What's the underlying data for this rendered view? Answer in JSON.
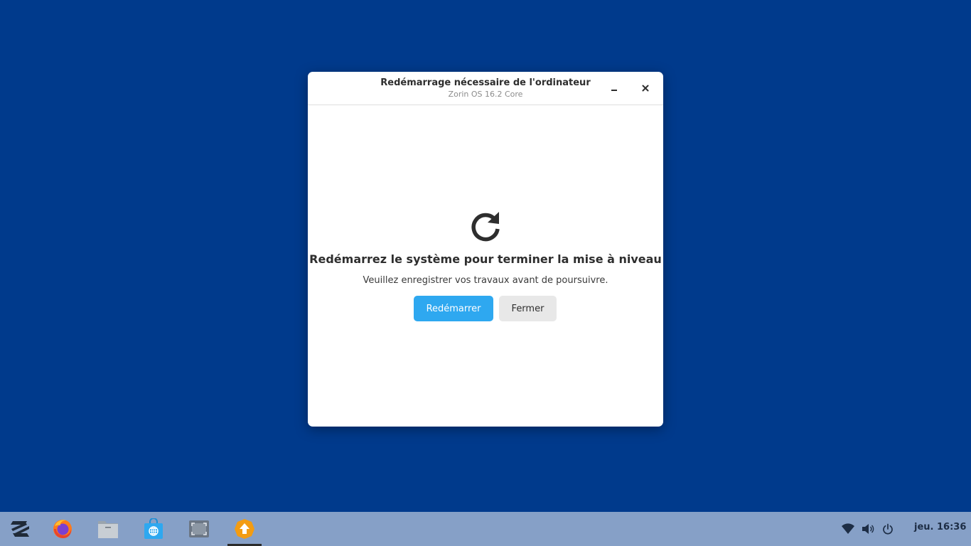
{
  "dialog": {
    "title": "Redémarrage nécessaire de l'ordinateur",
    "subtitle": "Zorin OS 16.2 Core",
    "headline": "Redémarrez le système pour terminer la mise à niveau",
    "message": "Veuillez enregistrer vos travaux avant de poursuivre.",
    "restart_label": "Redémarrer",
    "close_label": "Fermer",
    "icon": "refresh-icon"
  },
  "taskbar": {
    "items": [
      {
        "name": "zorin-menu",
        "icon": "zorin-logo-icon"
      },
      {
        "name": "firefox",
        "icon": "firefox-icon"
      },
      {
        "name": "files",
        "icon": "folder-icon"
      },
      {
        "name": "software-store",
        "icon": "store-icon"
      },
      {
        "name": "screenshot",
        "icon": "screenshot-icon"
      },
      {
        "name": "software-updater",
        "icon": "update-icon",
        "active": true
      }
    ],
    "tray": [
      "wifi-icon",
      "volume-icon",
      "power-icon"
    ],
    "clock": "jeu. 16:36"
  },
  "colors": {
    "desktop": "#003a8c",
    "taskbar": "#86a0c7",
    "accent": "#2ea8f0"
  }
}
